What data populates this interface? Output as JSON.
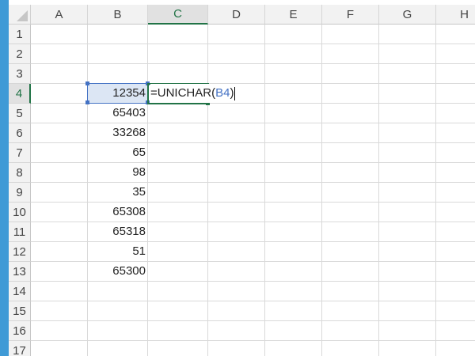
{
  "columns": [
    "A",
    "B",
    "C",
    "D",
    "E",
    "F",
    "G",
    "H"
  ],
  "active_column": "C",
  "rows": [
    "1",
    "2",
    "3",
    "4",
    "5",
    "6",
    "7",
    "8",
    "9",
    "10",
    "11",
    "12",
    "13",
    "14",
    "15",
    "16",
    "17"
  ],
  "active_row": "4",
  "column_b_values": {
    "4": "12354",
    "5": "65403",
    "6": "33268",
    "7": "65",
    "8": "98",
    "9": "35",
    "10": "65308",
    "11": "65318",
    "12": "51",
    "13": "65300"
  },
  "edit_cell": {
    "address": "C4",
    "formula_func": "=UNICHAR(",
    "formula_arg": "B4",
    "formula_close": ")"
  },
  "colors": {
    "accent_green": "#217346",
    "ref_blue": "#4472c4",
    "ref_fill": "#dce6f4"
  }
}
